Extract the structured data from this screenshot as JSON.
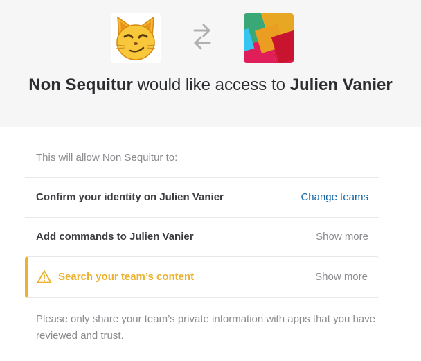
{
  "header": {
    "requesting_app": "Non Sequitur",
    "title_middle": " would like access to ",
    "team_name": "Julien Vanier",
    "requesting_app_icon": "cat-emoji-icon",
    "swap_icon": "swap-arrows-icon",
    "team_icon": "slack-logo-icon"
  },
  "permissions": {
    "intro": "This will allow Non Sequitur to:",
    "items": [
      {
        "label": "Confirm your identity on Julien Vanier",
        "action": "Change teams"
      },
      {
        "label": "Add commands to Julien Vanier",
        "action": "Show more"
      },
      {
        "label": "Search your team’s content",
        "action": "Show more",
        "icon": "warning-icon"
      }
    ],
    "footer_note": "Please only share your team’s private information with apps that you have reviewed and trust."
  },
  "colors": {
    "header_bg": "#f6f6f6",
    "link_blue": "#1264a3",
    "warning_yellow": "#ecb22e",
    "muted_text": "#8a8b8f"
  }
}
